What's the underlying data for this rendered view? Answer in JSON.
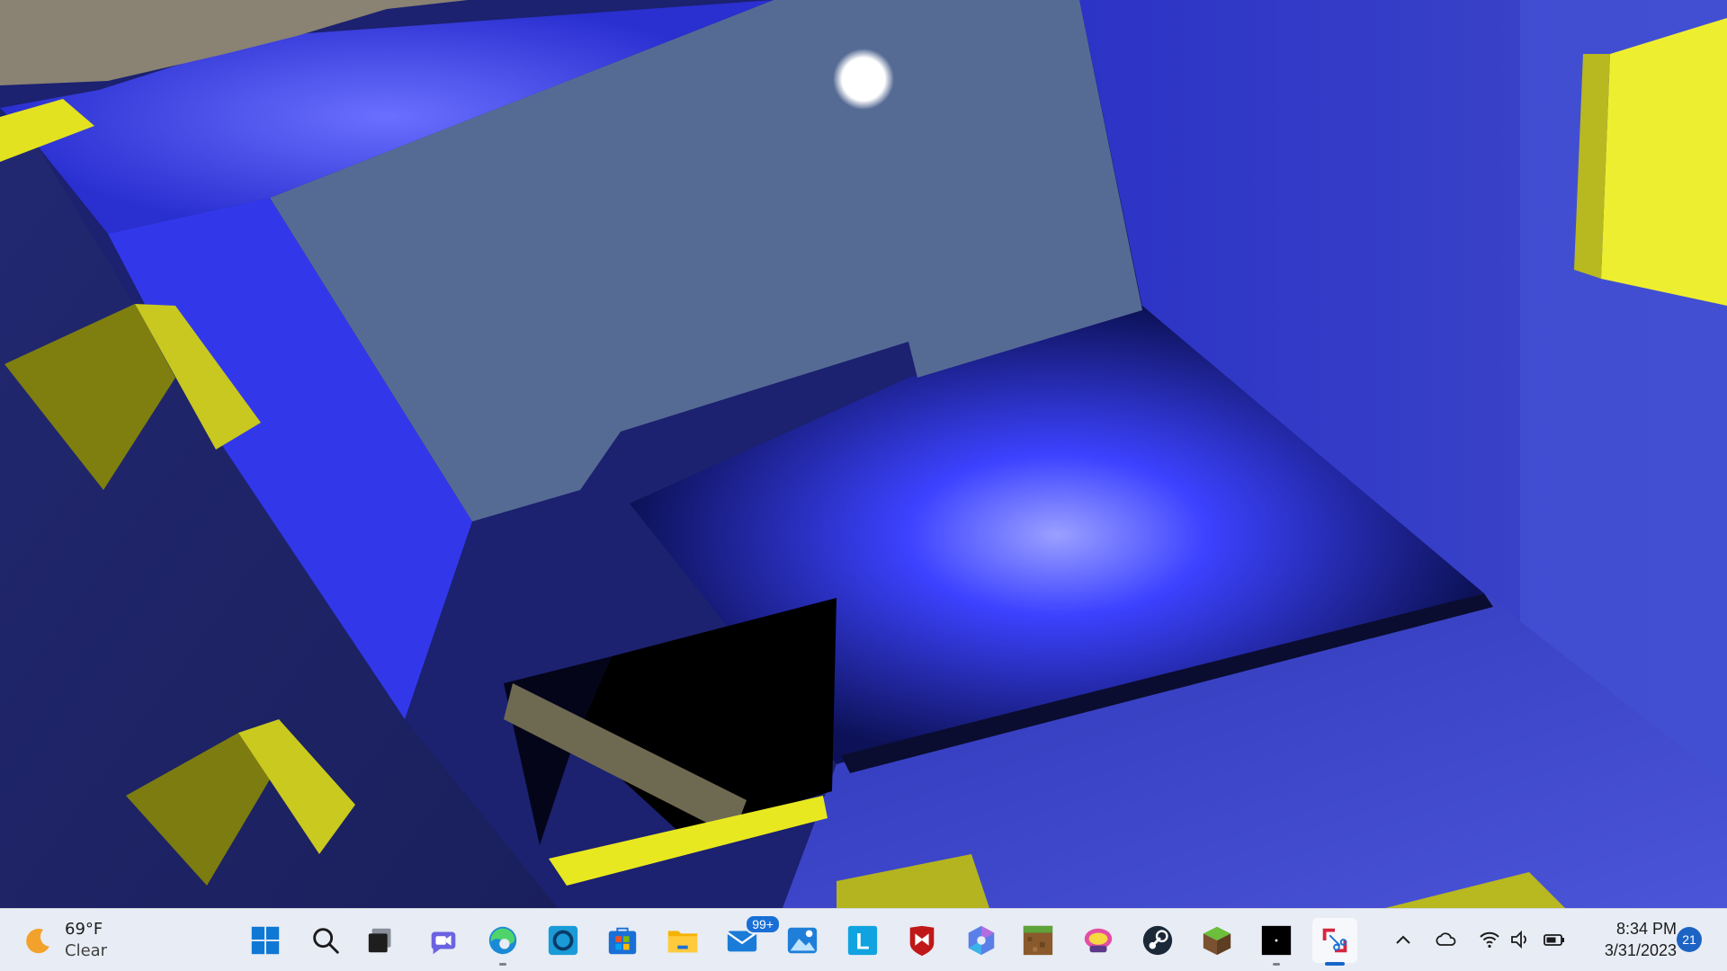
{
  "desktop": {
    "scene": "3d-game-view"
  },
  "taskbar": {
    "weather": {
      "temp": "69°F",
      "condition": "Clear",
      "icon": "moon-icon"
    },
    "apps": [
      {
        "name": "start-button",
        "icon": "windows-logo-icon"
      },
      {
        "name": "search-button",
        "icon": "search-icon"
      },
      {
        "name": "task-view-button",
        "icon": "task-view-icon"
      },
      {
        "name": "teams-chat-app",
        "icon": "chat-icon"
      },
      {
        "name": "edge-app",
        "icon": "edge-icon"
      },
      {
        "name": "cortana-app",
        "icon": "cortana-icon"
      },
      {
        "name": "store-app",
        "icon": "store-icon"
      },
      {
        "name": "file-explorer-app",
        "icon": "folder-icon"
      },
      {
        "name": "mail-app",
        "icon": "mail-icon",
        "badge": "99+"
      },
      {
        "name": "photos-app",
        "icon": "photos-icon"
      },
      {
        "name": "l-app",
        "icon": "letter-l-icon",
        "letter": "L"
      },
      {
        "name": "mcafee-app",
        "icon": "mcafee-icon"
      },
      {
        "name": "copilot-app",
        "icon": "hexagon-icon"
      },
      {
        "name": "minecraft-dungeons-app",
        "icon": "grass-block-icon"
      },
      {
        "name": "game-app",
        "icon": "game-logo-icon"
      },
      {
        "name": "steam-app",
        "icon": "steam-icon"
      },
      {
        "name": "minecraft-app",
        "icon": "minecraft-icon"
      },
      {
        "name": "terminal-app",
        "icon": "black-window-icon"
      },
      {
        "name": "snipping-tool-app",
        "icon": "snip-icon"
      }
    ],
    "tray": {
      "overflow": "chevron-up-icon",
      "onedrive": "cloud-icon",
      "wifi": "wifi-icon",
      "volume": "speaker-icon",
      "battery": "battery-icon"
    },
    "clock": {
      "time": "8:34 PM",
      "date": "3/31/2023"
    },
    "notifications": "21"
  },
  "colors": {
    "taskbar_bg": "#e8ecf4",
    "accent": "#1766c9",
    "cube_yellow": "#e8e820",
    "wall_blue": "#3a3fd8",
    "sky": "#566b94"
  }
}
